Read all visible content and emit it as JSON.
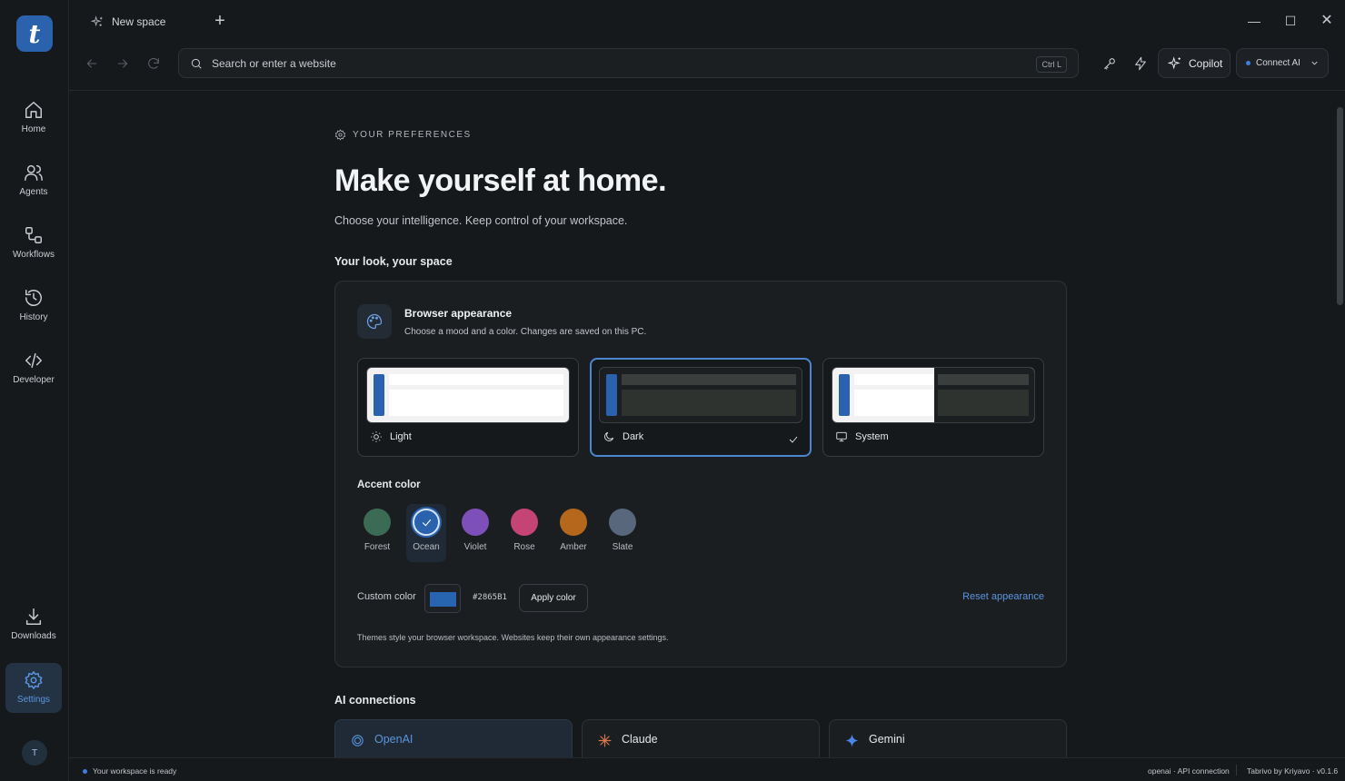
{
  "app": {
    "logo_letter": "t"
  },
  "tab": {
    "title": "New space"
  },
  "nav": {
    "items": [
      {
        "label": "Home",
        "icon": "home-icon"
      },
      {
        "label": "Agents",
        "icon": "users-icon"
      },
      {
        "label": "Workflows",
        "icon": "workflow-icon"
      },
      {
        "label": "History",
        "icon": "history-icon"
      },
      {
        "label": "Developer",
        "icon": "code-icon"
      }
    ],
    "bottom": [
      {
        "label": "Downloads",
        "icon": "download-icon"
      },
      {
        "label": "Settings",
        "icon": "gear-icon",
        "active": true
      }
    ],
    "avatar": "T"
  },
  "toolbar": {
    "search_placeholder": "Search or enter a website",
    "shortcut": "Ctrl L",
    "copilot_label": "Copilot",
    "connect_label": "Connect AI"
  },
  "page": {
    "eyebrow": "YOUR PREFERENCES",
    "title": "Make yourself at home.",
    "subtitle": "Choose your intelligence. Keep control of your workspace.",
    "section_look": "Your look, your space",
    "section_ai": "AI connections"
  },
  "appearance": {
    "title": "Browser appearance",
    "subtitle": "Choose a mood and a color. Changes are saved on this PC.",
    "modes": [
      {
        "label": "Light",
        "icon": "sun-icon"
      },
      {
        "label": "Dark",
        "icon": "moon-icon",
        "selected": true
      },
      {
        "label": "System",
        "icon": "monitor-icon"
      }
    ],
    "accent_title": "Accent color",
    "accents": [
      {
        "label": "Forest",
        "color": "#3c6b55"
      },
      {
        "label": "Ocean",
        "color": "#2a62ad",
        "selected": true
      },
      {
        "label": "Violet",
        "color": "#7d4fb8"
      },
      {
        "label": "Rose",
        "color": "#c44476"
      },
      {
        "label": "Amber",
        "color": "#b5681c"
      },
      {
        "label": "Slate",
        "color": "#58677c"
      }
    ],
    "custom_label": "Custom color",
    "custom_hex": "#2865B1",
    "apply_label": "Apply color",
    "reset_label": "Reset appearance",
    "footnote": "Themes style your browser workspace. Websites keep their own appearance settings."
  },
  "ai_connections": [
    {
      "label": "OpenAI",
      "icon": "openai-icon",
      "selected": true
    },
    {
      "label": "Claude",
      "icon": "claude-icon"
    },
    {
      "label": "Gemini",
      "icon": "gemini-icon"
    }
  ],
  "status": {
    "left": "Your workspace is ready",
    "connection": "openai · API connection",
    "version": "Tabrivo by Kriyavo · v0.1.6"
  },
  "colors": {
    "accent": "#2a62ad",
    "accent_text": "#5b95de",
    "background": "#16191c"
  }
}
